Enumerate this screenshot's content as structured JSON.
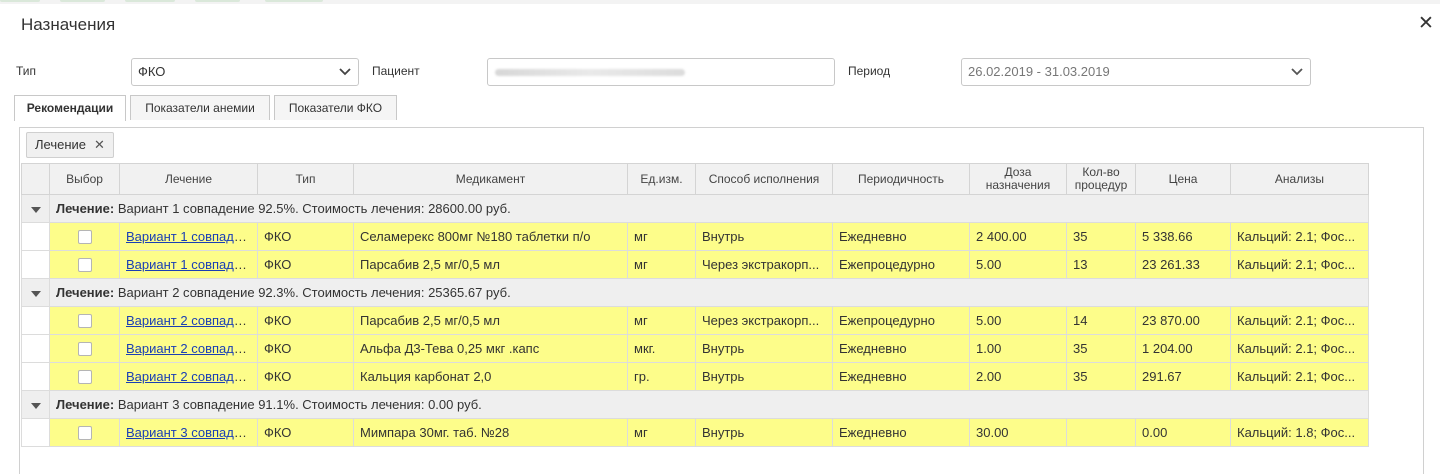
{
  "dialog": {
    "title": "Назначения"
  },
  "filters": {
    "type_label": "Тип",
    "type_value": "ФКО",
    "patient_label": "Пациент",
    "period_label": "Период",
    "period_value": "26.02.2019 - 31.03.2019"
  },
  "tabs": [
    {
      "label": "Рекомендации",
      "active": true
    },
    {
      "label": "Показатели анемии",
      "active": false
    },
    {
      "label": "Показатели ФКО",
      "active": false
    }
  ],
  "group_chip": {
    "label": "Лечение"
  },
  "table": {
    "headers": {
      "select": "Выбор",
      "treatment": "Лечение",
      "type": "Тип",
      "drug": "Медикамент",
      "unit": "Ед.изм.",
      "method": "Способ исполнения",
      "period": "Периодичность",
      "dose_l1": "Доза",
      "dose_l2": "назначения",
      "count_l1": "Кол-во",
      "count_l2": "процедур",
      "price": "Цена",
      "analyses": "Анализы"
    },
    "groups": [
      {
        "key": "Лечение:",
        "text": "Вариант 1 совпадение 92.5%. Стоимость лечения: 28600.00 руб.",
        "rows": [
          {
            "treatment": "Вариант 1 совпаде...",
            "type": "ФКО",
            "drug": "Селамерекс 800мг №180 таблетки п/о",
            "unit": "мг",
            "method": "Внутрь",
            "period": "Ежедневно",
            "dose": "2 400.00",
            "count": "35",
            "price": "5 338.66",
            "analyses": "Кальций: 2.1; Фос..."
          },
          {
            "treatment": "Вариант 1 совпаде...",
            "type": "ФКО",
            "drug": "Парсабив 2,5 мг/0,5 мл",
            "unit": "мг",
            "method": "Через экстракорп...",
            "period": "Ежепроцедурно",
            "dose": "5.00",
            "count": "13",
            "price": "23 261.33",
            "analyses": "Кальций: 2.1; Фос..."
          }
        ]
      },
      {
        "key": "Лечение:",
        "text": "Вариант 2 совпадение 92.3%. Стоимость лечения: 25365.67 руб.",
        "rows": [
          {
            "treatment": "Вариант 2 совпаде...",
            "type": "ФКО",
            "drug": "Парсабив 2,5 мг/0,5 мл",
            "unit": "мг",
            "method": "Через экстракорп...",
            "period": "Ежепроцедурно",
            "dose": "5.00",
            "count": "14",
            "price": "23 870.00",
            "analyses": "Кальций: 2.1; Фос..."
          },
          {
            "treatment": "Вариант 2 совпаде...",
            "type": "ФКО",
            "drug": "Альфа Д3-Тева 0,25 мкг .капс",
            "unit": "мкг.",
            "method": "Внутрь",
            "period": "Ежедневно",
            "dose": "1.00",
            "count": "35",
            "price": "1 204.00",
            "analyses": "Кальций: 2.1; Фос..."
          },
          {
            "treatment": "Вариант 2 совпаде...",
            "type": "ФКО",
            "drug": "Кальция карбонат 2,0",
            "unit": "гр.",
            "method": "Внутрь",
            "period": "Ежедневно",
            "dose": "2.00",
            "count": "35",
            "price": "291.67",
            "analyses": "Кальций: 2.1; Фос..."
          }
        ]
      },
      {
        "key": "Лечение:",
        "text": "Вариант 3 совпадение 91.1%. Стоимость лечения: 0.00 руб.",
        "rows": [
          {
            "treatment": "Вариант 3 совпаде...",
            "type": "ФКО",
            "drug": "Мимпара 30мг. таб. №28",
            "unit": "мг",
            "method": "Внутрь",
            "period": "Ежедневно",
            "dose": "30.00",
            "count": "",
            "price": "0.00",
            "analyses": "Кальций: 1.8; Фос..."
          }
        ]
      }
    ]
  }
}
